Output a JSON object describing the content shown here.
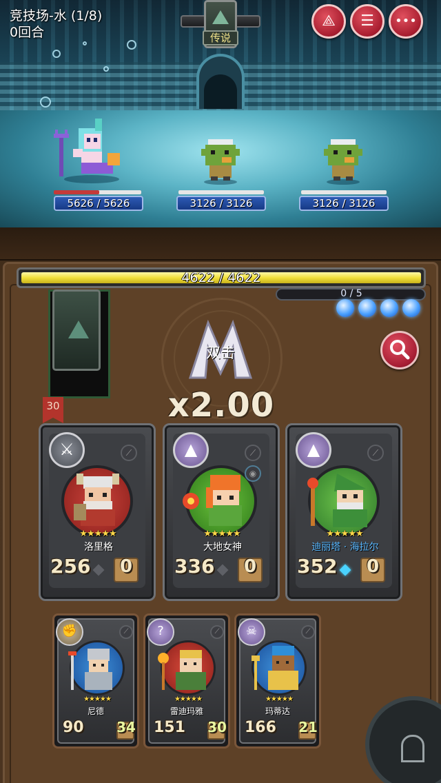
{
  "stage": {
    "title": "竞技场-水 (1/8)",
    "round": "0回合",
    "legend_label": "传说"
  },
  "top_buttons": [
    {
      "icon": "triangle-crest-icon",
      "glyph": "⟁"
    },
    {
      "icon": "scroll-icon",
      "glyph": "☰"
    },
    {
      "icon": "more-icon",
      "glyph": "•••"
    }
  ],
  "units": [
    {
      "name": "mermaid-hero",
      "hp": "5626 / 5626",
      "hp_fraction": 1.0
    },
    {
      "name": "goblin-enemy-1",
      "hp": "3126 / 3126",
      "hp_fraction": 1.0
    },
    {
      "name": "goblin-enemy-2",
      "hp": "3126 / 3126",
      "hp_fraction": 1.0
    }
  ],
  "boss_hp": {
    "text": "4622 / 4622",
    "fraction": 1.0
  },
  "mana": {
    "text": "0 / 5",
    "orbs": 4
  },
  "deck": {
    "count": "30"
  },
  "combo": {
    "label": "双击",
    "multiplier": "x2.00"
  },
  "heroes_main": [
    {
      "name": "洛里格",
      "stars": "★★★★★",
      "attack": "256",
      "bonus": "0",
      "class_icon": "axe-icon",
      "name_color": "#ffffff",
      "gem": "grey"
    },
    {
      "name": "大地女神",
      "stars": "★★★★★",
      "attack": "336",
      "bonus": "0",
      "class_icon": "witch-hat-icon",
      "name_color": "#ffffff",
      "gem": "grey"
    },
    {
      "name": "迪丽塔 · 海拉尔",
      "stars": "★★★★★",
      "attack": "352",
      "bonus": "0",
      "class_icon": "witch-hat-icon",
      "name_color": "#5ab8ff",
      "gem": "blue"
    }
  ],
  "heroes_sub": [
    {
      "name": "尼德",
      "stars": "★★★★★",
      "attack": "90",
      "bonus": "34",
      "class_icon": "fist-icon"
    },
    {
      "name": "雷迪玛雅",
      "stars": "★★★★★",
      "attack": "151",
      "bonus": "30",
      "class_icon": "swirl-icon"
    },
    {
      "name": "玛蒂达",
      "stars": "★★★★★",
      "attack": "166",
      "bonus": "21",
      "class_icon": "skull-icon"
    }
  ],
  "colors": {
    "hp_blue": "#2d5ab4",
    "boss_yellow": "#f1e03b",
    "mana_blue": "#4aa0ff",
    "button_red": "#c22a3b"
  }
}
